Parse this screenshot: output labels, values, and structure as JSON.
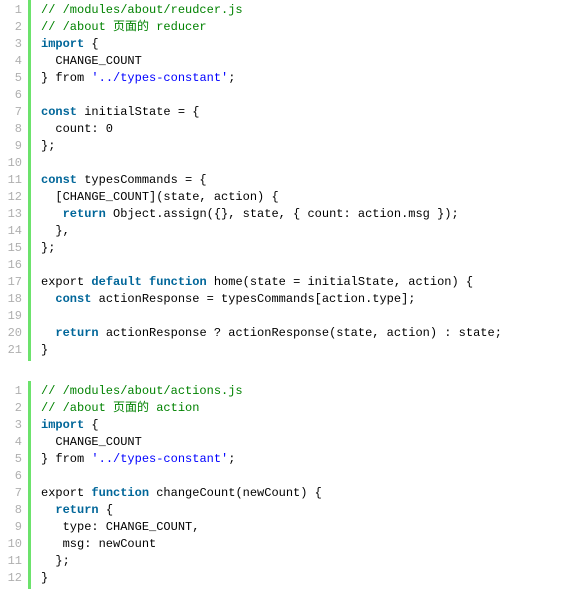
{
  "blocks": [
    {
      "lines": [
        {
          "num": "1",
          "seg": [
            {
              "c": "comment",
              "t": "// /modules/about/reudcer.js"
            }
          ]
        },
        {
          "num": "2",
          "seg": [
            {
              "c": "comment",
              "t": "// /about 页面的 reducer"
            }
          ]
        },
        {
          "num": "3",
          "seg": [
            {
              "c": "keyword",
              "t": "import"
            },
            {
              "c": "plain",
              "t": " {"
            }
          ]
        },
        {
          "num": "4",
          "seg": [
            {
              "c": "plain",
              "t": "  CHANGE_COUNT"
            }
          ]
        },
        {
          "num": "5",
          "seg": [
            {
              "c": "plain",
              "t": "} from "
            },
            {
              "c": "string",
              "t": "'../types-constant'"
            },
            {
              "c": "plain",
              "t": ";"
            }
          ]
        },
        {
          "num": "6",
          "seg": [
            {
              "c": "plain",
              "t": ""
            }
          ]
        },
        {
          "num": "7",
          "seg": [
            {
              "c": "keyword",
              "t": "const"
            },
            {
              "c": "plain",
              "t": " initialState = {"
            }
          ]
        },
        {
          "num": "8",
          "seg": [
            {
              "c": "plain",
              "t": "  count: 0"
            }
          ]
        },
        {
          "num": "9",
          "seg": [
            {
              "c": "plain",
              "t": "};"
            }
          ]
        },
        {
          "num": "10",
          "seg": [
            {
              "c": "plain",
              "t": ""
            }
          ]
        },
        {
          "num": "11",
          "seg": [
            {
              "c": "keyword",
              "t": "const"
            },
            {
              "c": "plain",
              "t": " typesCommands = {"
            }
          ]
        },
        {
          "num": "12",
          "seg": [
            {
              "c": "plain",
              "t": "  [CHANGE_COUNT](state, action) {"
            }
          ]
        },
        {
          "num": "13",
          "seg": [
            {
              "c": "plain",
              "t": "   "
            },
            {
              "c": "keyword",
              "t": "return"
            },
            {
              "c": "plain",
              "t": " Object.assign({}, state, { count: action.msg });"
            }
          ]
        },
        {
          "num": "14",
          "seg": [
            {
              "c": "plain",
              "t": "  },"
            }
          ]
        },
        {
          "num": "15",
          "seg": [
            {
              "c": "plain",
              "t": "};"
            }
          ]
        },
        {
          "num": "16",
          "seg": [
            {
              "c": "plain",
              "t": ""
            }
          ]
        },
        {
          "num": "17",
          "seg": [
            {
              "c": "plain",
              "t": "export "
            },
            {
              "c": "keyword",
              "t": "default"
            },
            {
              "c": "plain",
              "t": " "
            },
            {
              "c": "keyword",
              "t": "function"
            },
            {
              "c": "plain",
              "t": " home(state = initialState, action) {"
            }
          ]
        },
        {
          "num": "18",
          "seg": [
            {
              "c": "plain",
              "t": "  "
            },
            {
              "c": "keyword",
              "t": "const"
            },
            {
              "c": "plain",
              "t": " actionResponse = typesCommands[action.type];"
            }
          ]
        },
        {
          "num": "19",
          "seg": [
            {
              "c": "plain",
              "t": ""
            }
          ]
        },
        {
          "num": "20",
          "seg": [
            {
              "c": "plain",
              "t": "  "
            },
            {
              "c": "keyword",
              "t": "return"
            },
            {
              "c": "plain",
              "t": " actionResponse ? actionResponse(state, action) : state;"
            }
          ]
        },
        {
          "num": "21",
          "seg": [
            {
              "c": "plain",
              "t": "}"
            }
          ]
        }
      ]
    },
    {
      "lines": [
        {
          "num": "1",
          "seg": [
            {
              "c": "comment",
              "t": "// /modules/about/actions.js"
            }
          ]
        },
        {
          "num": "2",
          "seg": [
            {
              "c": "comment",
              "t": "// /about 页面的 action"
            }
          ]
        },
        {
          "num": "3",
          "seg": [
            {
              "c": "keyword",
              "t": "import"
            },
            {
              "c": "plain",
              "t": " {"
            }
          ]
        },
        {
          "num": "4",
          "seg": [
            {
              "c": "plain",
              "t": "  CHANGE_COUNT"
            }
          ]
        },
        {
          "num": "5",
          "seg": [
            {
              "c": "plain",
              "t": "} from "
            },
            {
              "c": "string",
              "t": "'../types-constant'"
            },
            {
              "c": "plain",
              "t": ";"
            }
          ]
        },
        {
          "num": "6",
          "seg": [
            {
              "c": "plain",
              "t": ""
            }
          ]
        },
        {
          "num": "7",
          "seg": [
            {
              "c": "plain",
              "t": "export "
            },
            {
              "c": "keyword",
              "t": "function"
            },
            {
              "c": "plain",
              "t": " changeCount(newCount) {"
            }
          ]
        },
        {
          "num": "8",
          "seg": [
            {
              "c": "plain",
              "t": "  "
            },
            {
              "c": "keyword",
              "t": "return"
            },
            {
              "c": "plain",
              "t": " {"
            }
          ]
        },
        {
          "num": "9",
          "seg": [
            {
              "c": "plain",
              "t": "   type: CHANGE_COUNT,"
            }
          ]
        },
        {
          "num": "10",
          "seg": [
            {
              "c": "plain",
              "t": "   msg: newCount"
            }
          ]
        },
        {
          "num": "11",
          "seg": [
            {
              "c": "plain",
              "t": "  };"
            }
          ]
        },
        {
          "num": "12",
          "seg": [
            {
              "c": "plain",
              "t": "}"
            }
          ]
        }
      ]
    }
  ]
}
